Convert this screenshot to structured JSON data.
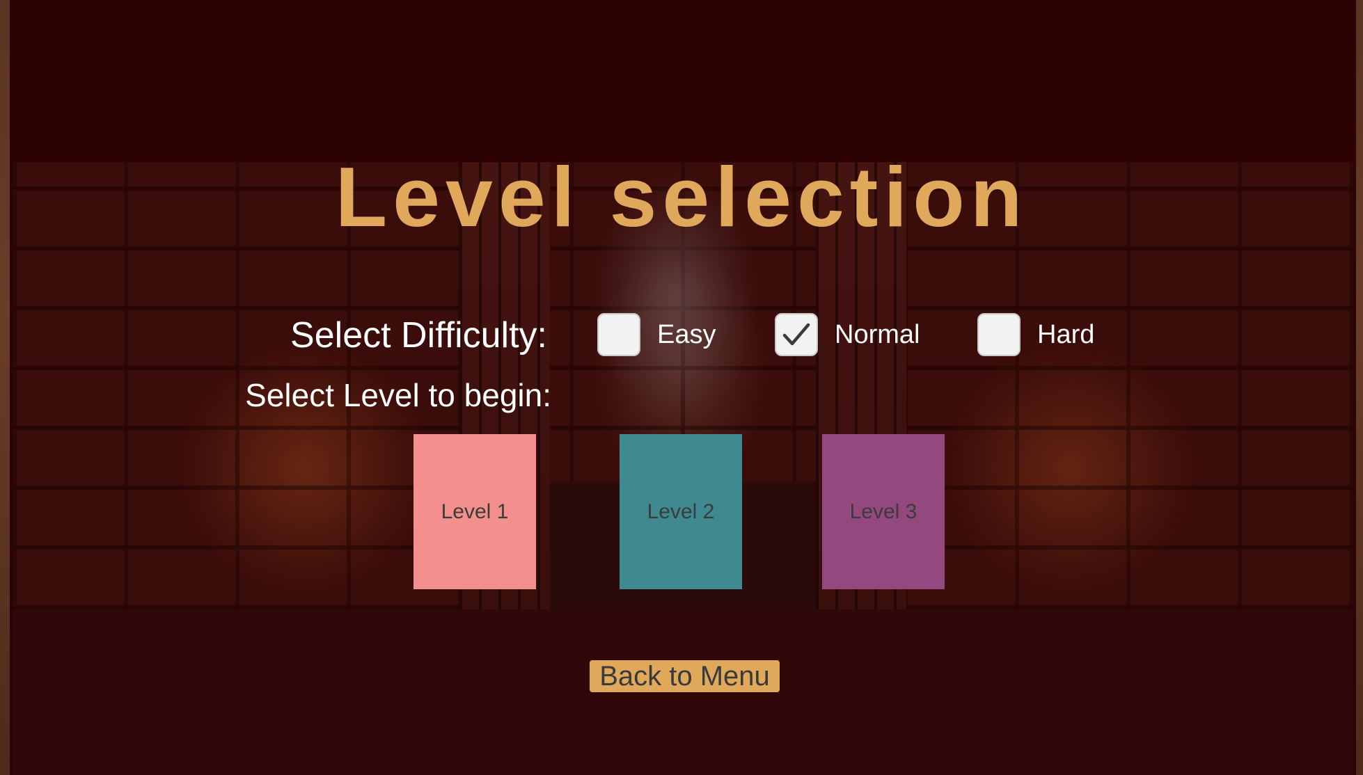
{
  "title": "Level selection",
  "difficulty": {
    "label": "Select Difficulty:",
    "options": [
      {
        "label": "Easy",
        "checked": false
      },
      {
        "label": "Normal",
        "checked": true
      },
      {
        "label": "Hard",
        "checked": false
      }
    ]
  },
  "levels": {
    "label": "Select Level to begin:",
    "buttons": [
      {
        "label": "Level 1",
        "color": "#f38f8c"
      },
      {
        "label": "Level 2",
        "color": "#3f8a91"
      },
      {
        "label": "Level 3",
        "color": "#93487f"
      }
    ]
  },
  "back_button": {
    "label": "Back to Menu"
  },
  "colors": {
    "accent": "#e0a85a",
    "background": "#2c0203",
    "text": "#ffffff"
  },
  "icons": {
    "checkmark": "checkmark-icon"
  }
}
